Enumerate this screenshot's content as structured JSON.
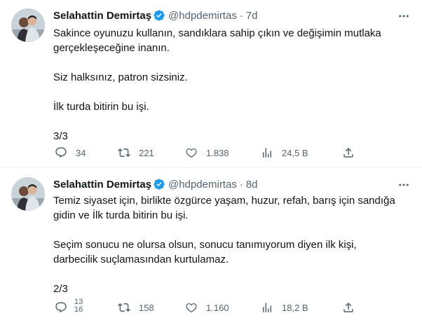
{
  "tweets": [
    {
      "name": "Selahattin Demirtaş",
      "handle": "@hdpdemirtas",
      "dot": "·",
      "time": "7d",
      "paragraphs": [
        "Sakince oyunuzu kullanın, sandıklara sahip çıkın ve değişimin mutlaka\ngerçekleşeceğine inanın.",
        "Siz halksınız, patron sizsiniz.",
        "İlk turda bitirin bu işi.",
        "3/3"
      ],
      "replies": "34",
      "retweets": "221",
      "likes": "1.838",
      "views": "24,5 B"
    },
    {
      "name": "Selahattin Demirtaş",
      "handle": "@hdpdemirtas",
      "dot": "·",
      "time": "8d",
      "paragraphs": [
        "Temiz siyaset için, birlikte özgürce yaşam, huzur, refah, barış için sandığa\ngidin ve İlk turda bitirin bu işi.",
        "Seçim sonucu ne olursa olsun, sonucu tanımıyorum diyen ilk kişi,\ndarbecilik suçlamasından kurtulamaz.",
        "2/3"
      ],
      "replies_top": "13",
      "replies_bottom": "16",
      "retweets": "158",
      "likes": "1.160",
      "views": "18,2 B"
    }
  ],
  "icons": [
    "verified-badge-icon",
    "more-icon",
    "reply-icon",
    "retweet-icon",
    "like-icon",
    "views-icon",
    "share-icon"
  ],
  "colors": {
    "text": "#0f1419",
    "secondary": "#536471",
    "verified": "#1d9bf0",
    "divider": "#eff3f4"
  }
}
